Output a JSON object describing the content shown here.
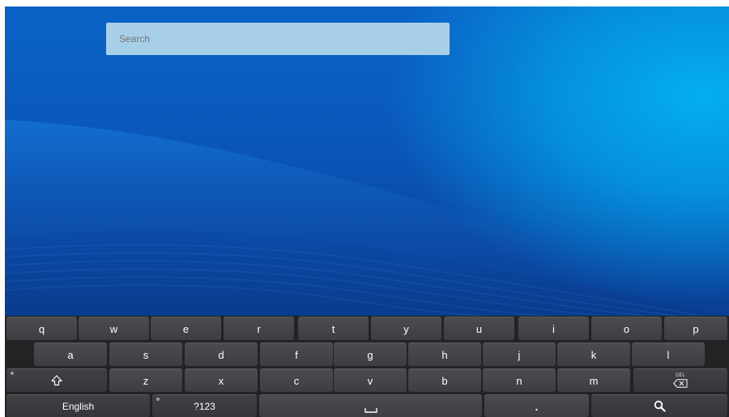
{
  "search": {
    "placeholder": "Search"
  },
  "keyboard": {
    "row1": [
      "q",
      "w",
      "e",
      "r",
      "t",
      "y",
      "u",
      "i",
      "o",
      "p"
    ],
    "row2": [
      "a",
      "s",
      "d",
      "f",
      "g",
      "h",
      "j",
      "k",
      "l"
    ],
    "row3": [
      "z",
      "x",
      "c",
      "v",
      "b",
      "n",
      "m"
    ],
    "language_label": "English",
    "symbols_label": "?123",
    "period_label": ".",
    "delete_badge": "DEL",
    "icons": {
      "shift": "shift-icon",
      "delete": "backspace-icon",
      "space": "space-bar-icon",
      "search": "search-icon"
    }
  },
  "colors": {
    "wallpaper_primary": "#0a58bb",
    "wallpaper_highlight": "#04aef0",
    "keyboard_bg": "#222325",
    "key_bg": "#45474b"
  }
}
